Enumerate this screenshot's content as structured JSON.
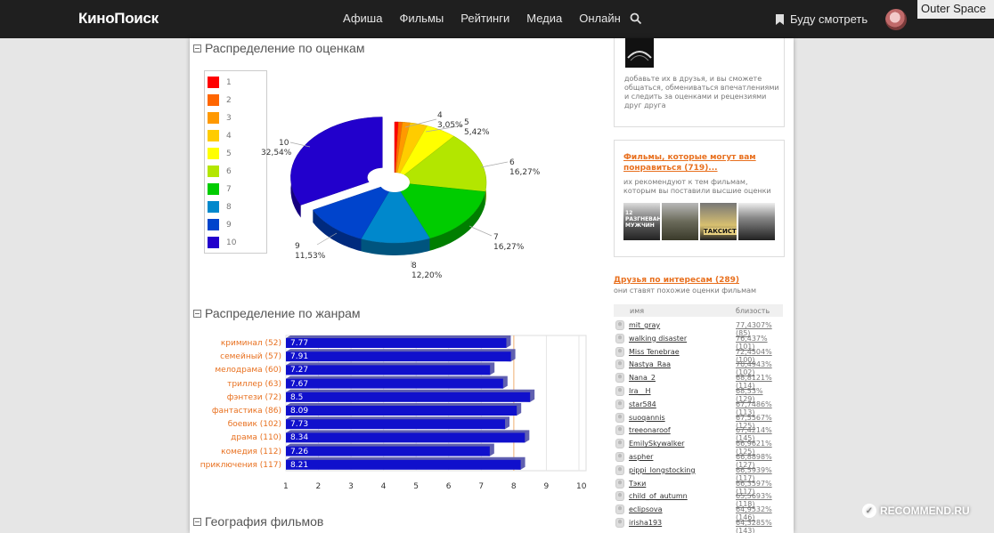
{
  "header": {
    "logo": "КиноПоиск",
    "nav": [
      "Афиша",
      "Фильмы",
      "Рейтинги",
      "Медиа",
      "Онлайн"
    ],
    "watch_later": "Буду смотреть",
    "overlay_title": "Outer Space"
  },
  "sections": {
    "ratings_title": "Распределение по оценкам",
    "genres_title": "Распределение по жанрам",
    "geo_title": "География фильмов"
  },
  "chart_data": [
    {
      "type": "pie",
      "title": "Распределение по оценкам",
      "legend": [
        "1",
        "2",
        "3",
        "4",
        "5",
        "6",
        "7",
        "8",
        "9",
        "10"
      ],
      "colors": [
        "#ff0000",
        "#ff6600",
        "#ff9900",
        "#ffcc00",
        "#ffff00",
        "#b3e600",
        "#00cc00",
        "#0088cc",
        "#0044cc",
        "#2200cc"
      ],
      "labels": [
        "1",
        "2",
        "3",
        "4",
        "5",
        "6",
        "7",
        "8",
        "9",
        "10"
      ],
      "values": [
        0.68,
        0.68,
        1.36,
        3.05,
        5.42,
        16.27,
        16.27,
        12.2,
        11.53,
        32.54
      ],
      "shown_labels": [
        {
          "name": "4",
          "pct": "3,05%"
        },
        {
          "name": "5",
          "pct": "5,42%"
        },
        {
          "name": "6",
          "pct": "16,27%"
        },
        {
          "name": "7",
          "pct": "16,27%"
        },
        {
          "name": "8",
          "pct": "12,20%"
        },
        {
          "name": "9",
          "pct": "11,53%"
        },
        {
          "name": "10",
          "pct": "32,54%"
        }
      ]
    },
    {
      "type": "bar",
      "title": "Распределение по жанрам",
      "categories": [
        "криминал (52)",
        "семейный (57)",
        "мелодрама (60)",
        "триллер (63)",
        "фэнтези (72)",
        "фантастика (86)",
        "боевик (102)",
        "драма (110)",
        "комедия (112)",
        "приключения (117)"
      ],
      "values": [
        7.77,
        7.91,
        7.27,
        7.67,
        8.5,
        8.09,
        7.73,
        8.34,
        7.26,
        8.21
      ],
      "value_labels": [
        "7.77",
        "7.91",
        "7.27",
        "7.67",
        "8.5",
        "8.09",
        "7.73",
        "8.34",
        "7.26",
        "8.21"
      ],
      "xlim": [
        1,
        10
      ],
      "xticks": [
        "1",
        "2",
        "3",
        "4",
        "5",
        "6",
        "7",
        "8",
        "9",
        "10"
      ],
      "bar_color": "#1010cc"
    }
  ],
  "sidebar": {
    "friends_promo_text": "добавьте их в друзья, и вы сможете общаться, обмениваться впечатлениями и следить за оценками и рецензиями друг друга",
    "recommend_link": "Фильмы, которые могут вам понравиться (719)...",
    "recommend_text": "их рекомендуют к тем фильмам, которым вы поставили высшие оценки",
    "posters": [
      "12 разгневанных мужчин",
      "poster-2",
      "Таксист",
      "poster-4"
    ],
    "poster_caption_1": "12 РАЗГНЕВАННЫХ МУЖЧИН",
    "poster_caption_3": "ТАКСИСТ",
    "interest_link": "Друзья по интересам (289)",
    "interest_sub": "они ставят похожие оценки фильмам",
    "table_head": {
      "name": "имя",
      "closeness": "близость"
    },
    "friends": [
      {
        "name": "mit_gray",
        "closeness": "77,4307% (85)"
      },
      {
        "name": "walking disaster",
        "closeness": "76,437% (101)"
      },
      {
        "name": "Miss Tenebrae",
        "closeness": "72,4504% (100)"
      },
      {
        "name": "Nastya_Raa",
        "closeness": "70,4943% (102)"
      },
      {
        "name": "Nana_2",
        "closeness": "68,8121% (114)"
      },
      {
        "name": "Ira__H",
        "closeness": "68,53% (129)"
      },
      {
        "name": "star584",
        "closeness": "67,7486% (113)"
      },
      {
        "name": "suoqannis",
        "closeness": "67,5567% (125)"
      },
      {
        "name": "treeonaroof",
        "closeness": "67,4214% (145)"
      },
      {
        "name": "EmilySkywalker",
        "closeness": "66,9621% (125)"
      },
      {
        "name": "aspher",
        "closeness": "66,8898% (127)"
      },
      {
        "name": "pippi_longstocking",
        "closeness": "66,5939% (117)"
      },
      {
        "name": "Тэки",
        "closeness": "66,3597% (117)"
      },
      {
        "name": "child_of_autumn",
        "closeness": "65,5693% (118)"
      },
      {
        "name": "eclipsova",
        "closeness": "64,9532% (146)"
      },
      {
        "name": "irisha193",
        "closeness": "64,3285% (143)"
      }
    ]
  },
  "watermark": "RECOMMEND.RU"
}
